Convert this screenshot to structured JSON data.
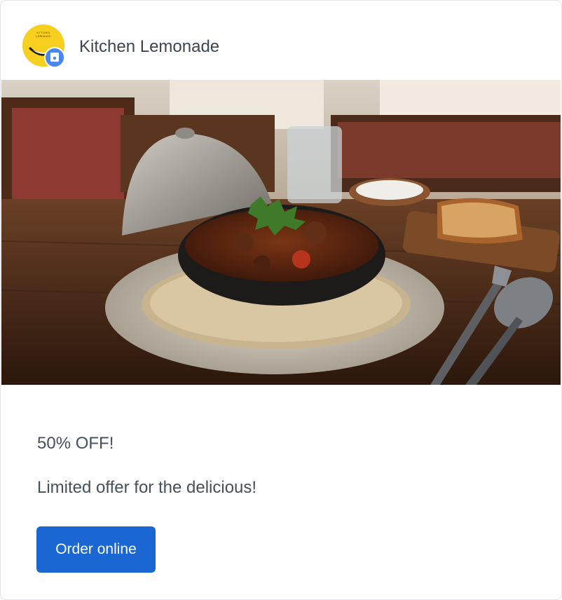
{
  "business": {
    "name": "Kitchen Lemonade",
    "logo_text": "KITCHEN LEMONADE",
    "logo_color": "#f7cf1f",
    "badge_icon": "store-icon",
    "badge_color": "#4b86ec"
  },
  "hero": {
    "icon": "food-photo"
  },
  "offer": {
    "headline": "50% OFF!",
    "description": "Limited offer for the delicious!"
  },
  "cta": {
    "label": "Order online",
    "color": "#1a66d2"
  }
}
